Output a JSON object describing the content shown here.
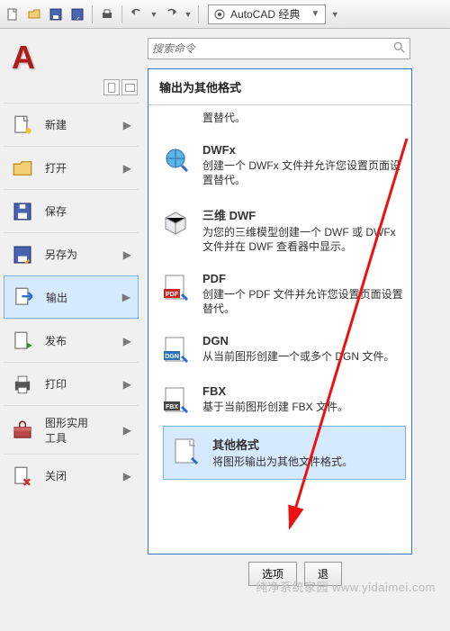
{
  "workspace": {
    "label": "AutoCAD 经典"
  },
  "search": {
    "placeholder": "搜索命令"
  },
  "appmenu": {
    "items": [
      {
        "label": "新建"
      },
      {
        "label": "打开"
      },
      {
        "label": "保存"
      },
      {
        "label": "另存为"
      },
      {
        "label": "输出"
      },
      {
        "label": "发布"
      },
      {
        "label": "打印"
      },
      {
        "label": "图形实用\n工具"
      },
      {
        "label": "关闭"
      }
    ]
  },
  "submenu": {
    "header": "输出为其他格式",
    "items": [
      {
        "title": "",
        "desc": "置替代。"
      },
      {
        "title": "DWFx",
        "desc": "创建一个 DWFx 文件并允许您设置页面设置替代。"
      },
      {
        "title": "三维 DWF",
        "desc": "为您的三维模型创建一个 DWF 或 DWFx 文件并在 DWF 查看器中显示。"
      },
      {
        "title": "PDF",
        "desc": "创建一个 PDF 文件并允许您设置页面设置替代。"
      },
      {
        "title": "DGN",
        "desc": "从当前图形创建一个或多个 DGN 文件。"
      },
      {
        "title": "FBX",
        "desc": "基于当前图形创建 FBX 文件。"
      },
      {
        "title": "其他格式",
        "desc": "将图形输出为其他文件格式。"
      }
    ]
  },
  "buttons": {
    "options": "选项",
    "exit": "退"
  },
  "watermark": "纯净系统家园 www.yidaimei.com"
}
